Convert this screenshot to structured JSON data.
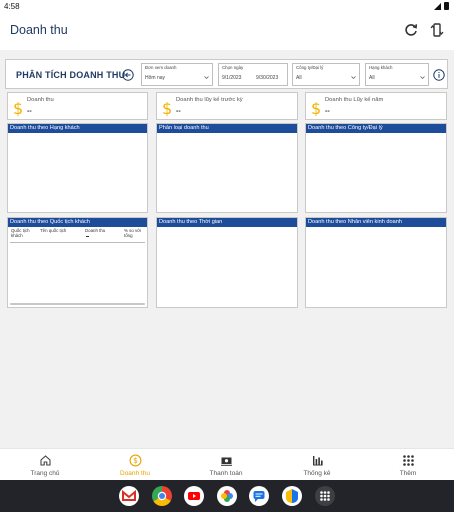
{
  "status_bar": {
    "time": "4:58"
  },
  "app_bar": {
    "title": "Doanh thu"
  },
  "header": {
    "title": "PHÂN TÍCH DOANH THU"
  },
  "filters": [
    {
      "label": "Đơn xem doanh",
      "value": "Hôm nay"
    },
    {
      "label": "Chọn ngày",
      "start": "9/1/2023",
      "end": "9/30/2023"
    },
    {
      "label": "Công ty/Đại lý",
      "value": "All"
    },
    {
      "label": "Hạng khách",
      "value": "All"
    }
  ],
  "kpis": [
    {
      "icon": "dollar-icon",
      "label": "Doanh thu",
      "value": "--"
    },
    {
      "icon": "dollar-icon",
      "label": "Doanh thu lũy kế trước kỳ",
      "value": "--"
    },
    {
      "icon": "dollar-icon",
      "label": "Doanh thu Lũy kế năm",
      "value": "--"
    }
  ],
  "panels": [
    {
      "title": "Doanh thu theo Hạng khách"
    },
    {
      "title": "Phân loại doanh thu"
    },
    {
      "title": "Doanh thu theo Công ty/Đại lý"
    },
    {
      "title": "Doanh thu theo Quốc tịch khách"
    },
    {
      "title": "Doanh thu theo Thời gian"
    },
    {
      "title": "Doanh thu theo Nhân viên kinh doanh"
    }
  ],
  "nationality_table": {
    "columns": [
      "Quốc tịch khách",
      "Tên quốc tịch",
      "Doanh thu",
      "% so với tổng"
    ]
  },
  "bottom_nav": [
    {
      "label": "Trang chủ",
      "icon": "home-icon",
      "active": false
    },
    {
      "label": "Doanh thu",
      "icon": "dollar-circle-icon",
      "active": true
    },
    {
      "label": "Thanh toán",
      "icon": "payment-icon",
      "active": false
    },
    {
      "label": "Thống kê",
      "icon": "bar-chart-icon",
      "active": false
    },
    {
      "label": "Thêm",
      "icon": "grid-menu-icon",
      "active": false
    }
  ],
  "colors": {
    "accent": "#1d4c9b",
    "title": "#1f3a64",
    "active_nav": "#e8a300",
    "dollar": "#f2b300"
  }
}
